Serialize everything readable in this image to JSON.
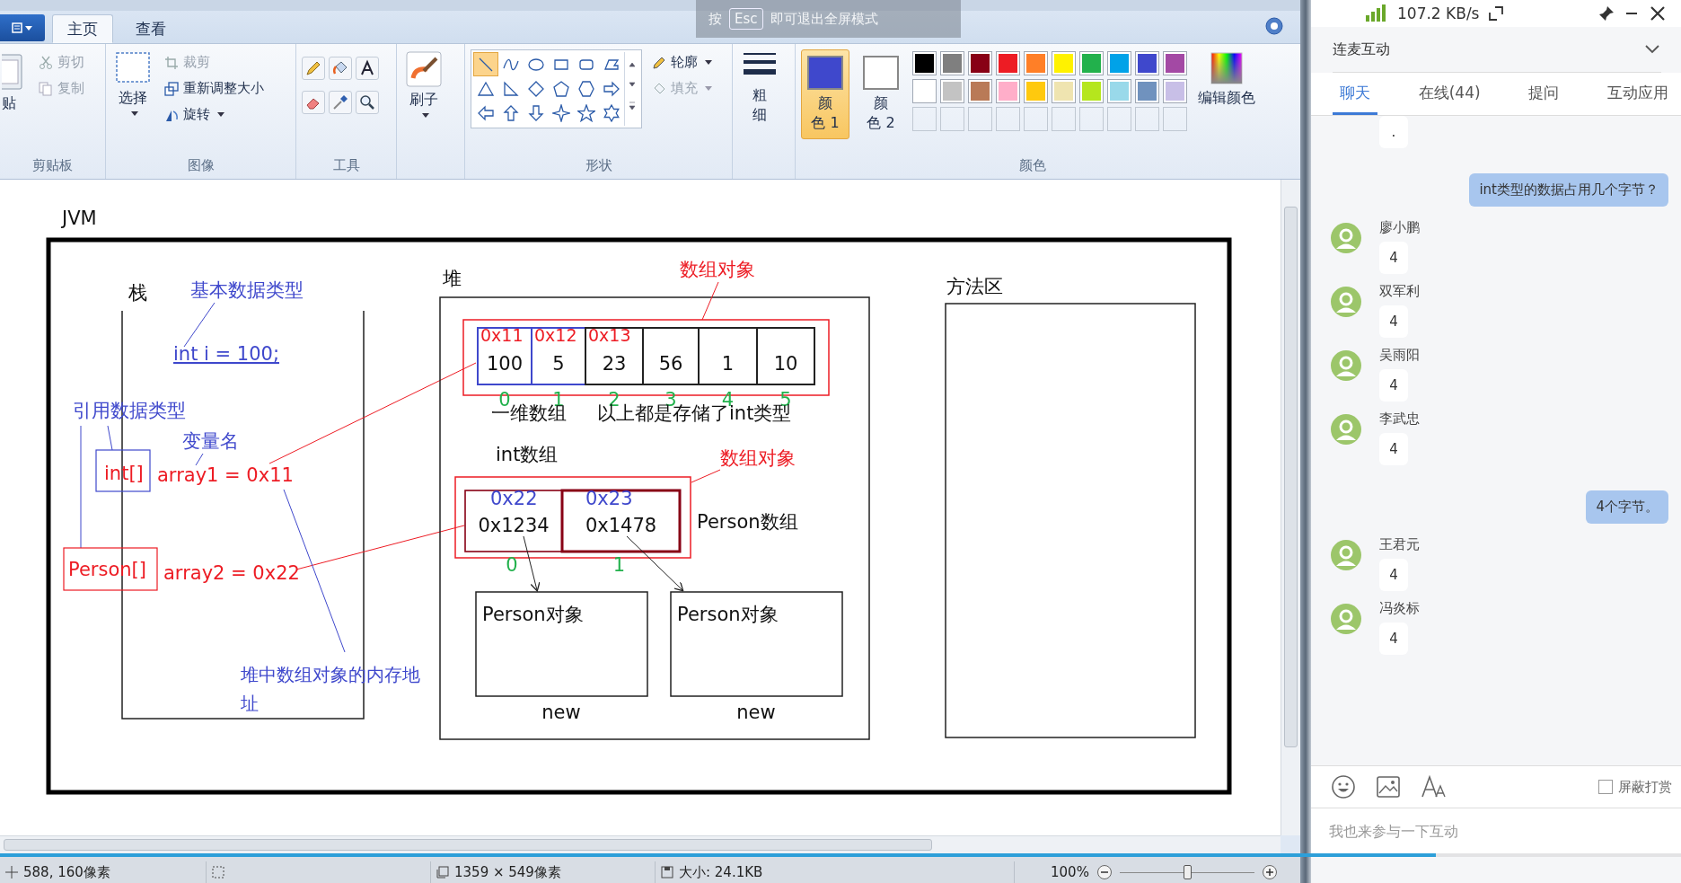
{
  "fullscreen_notice": {
    "before": "按",
    "key": "Esc",
    "after": "即可退出全屏模式"
  },
  "ribbon": {
    "tabs": [
      {
        "label": "主页",
        "selected": true
      },
      {
        "label": "查看",
        "selected": false
      }
    ],
    "clipboard": {
      "label": "剪贴板",
      "paste": "贴",
      "cut": {
        "label": "剪切",
        "disabled": true
      },
      "copy": {
        "label": "复制",
        "disabled": true
      }
    },
    "image": {
      "label": "图像",
      "select": "选择",
      "crop": {
        "label": "裁剪",
        "disabled": true
      },
      "resize": {
        "label": "重新调整大小",
        "disabled": false
      },
      "rotate": {
        "label": "旋转",
        "disabled": false
      }
    },
    "tools": {
      "label": "工具"
    },
    "brush": {
      "label": "刷子"
    },
    "shapes": {
      "label": "形状",
      "items": [
        {
          "kind": "line",
          "selected": true
        },
        {
          "kind": "curve",
          "selected": false
        },
        {
          "kind": "oval",
          "selected": false
        },
        {
          "kind": "rectangle",
          "selected": false
        },
        {
          "kind": "rounded-rectangle",
          "selected": false
        },
        {
          "kind": "polygon",
          "selected": false
        },
        {
          "kind": "triangle",
          "selected": false
        },
        {
          "kind": "right-triangle",
          "selected": false
        },
        {
          "kind": "diamond",
          "selected": false
        },
        {
          "kind": "pentagon",
          "selected": false
        },
        {
          "kind": "hexagon",
          "selected": false
        },
        {
          "kind": "right-arrow",
          "selected": false
        },
        {
          "kind": "left-arrow",
          "selected": false
        },
        {
          "kind": "up-arrow",
          "selected": false
        },
        {
          "kind": "down-arrow",
          "selected": false
        },
        {
          "kind": "four-point-star",
          "selected": false
        },
        {
          "kind": "five-point-star",
          "selected": false
        },
        {
          "kind": "six-point-star",
          "selected": false
        }
      ],
      "outline": {
        "label": "轮廓",
        "disabled": false
      },
      "fill": {
        "label": "填充",
        "disabled": true
      }
    },
    "size": {
      "lines": [
        "粗",
        "细"
      ]
    },
    "colors": {
      "label": "颜色",
      "slots": [
        {
          "lines": [
            "颜",
            "色 1"
          ],
          "selected": true,
          "color": "#3f48cc"
        },
        {
          "lines": [
            "颜",
            "色 2"
          ],
          "selected": false,
          "color": "#ffffff"
        }
      ],
      "palette": [
        {
          "color": "#000000"
        },
        {
          "color": "#7f7f7f"
        },
        {
          "color": "#880015"
        },
        {
          "color": "#ed1c24"
        },
        {
          "color": "#ff7f27"
        },
        {
          "color": "#fff200"
        },
        {
          "color": "#22b14c"
        },
        {
          "color": "#00a2e8"
        },
        {
          "color": "#3f48cc"
        },
        {
          "color": "#a349a4"
        },
        {
          "color": "#ffffff"
        },
        {
          "color": "#c3c3c3"
        },
        {
          "color": "#b97a57"
        },
        {
          "color": "#ffaec9"
        },
        {
          "color": "#ffc90e"
        },
        {
          "color": "#efe4b0"
        },
        {
          "color": "#b5e61d"
        },
        {
          "color": "#99d9ea"
        },
        {
          "color": "#7092be"
        },
        {
          "color": "#c8bfe7"
        }
      ],
      "edit": "编辑颜色"
    }
  },
  "canvas": {
    "title": "JVM",
    "stack": {
      "label": "栈",
      "primitive_note": "基本数据类型",
      "declaration": "int i = 100;",
      "reference_note": "引用数据类型",
      "variable_note": "变量名",
      "int_array_type": "int[]",
      "int_array_assign": "array1 = 0x11",
      "person_array_type": "Person[]",
      "person_array_assign": "array2 = 0x22",
      "address_note": "堆中数组对象的内存地址"
    },
    "heap": {
      "label": "堆",
      "int_array": {
        "caption": "数组对象",
        "cells": [
          {
            "address": "0x11",
            "value": "100",
            "index": "0"
          },
          {
            "address": "0x12",
            "value": "5",
            "index": "1"
          },
          {
            "address": "0x13",
            "value": "23",
            "index": "2"
          },
          {
            "value": "56",
            "index": "3"
          },
          {
            "value": "1",
            "index": "4"
          },
          {
            "value": "10",
            "index": "5"
          }
        ],
        "label": "一维数组",
        "note": "以上都是存储了int类型",
        "type_label": "int数组"
      },
      "person_array": {
        "caption": "数组对象",
        "cells": [
          {
            "address": "0x22",
            "value": "0x1234",
            "index": "0"
          },
          {
            "address": "0x23",
            "value": "0x1478",
            "index": "1"
          }
        ],
        "label": "Person数组"
      },
      "objects": [
        {
          "label": "Person对象",
          "note": "new"
        },
        {
          "label": "Person对象",
          "note": "new"
        }
      ]
    },
    "method_area": {
      "label": "方法区"
    }
  },
  "status_bar": {
    "position": "588, 160像素",
    "dimensions": "1359 × 549像素",
    "size": "大小: 24.1KB",
    "zoom": "100%",
    "level": 0.5
  },
  "chat": {
    "speed": "107.2 KB/s",
    "title": "连麦互动",
    "tabs": [
      {
        "label": "聊天",
        "selected": true
      },
      {
        "label": "在线(44)",
        "selected": false
      },
      {
        "label": "提问",
        "selected": false
      },
      {
        "label": "互动应用",
        "selected": false
      }
    ],
    "messages": [
      {
        "kind": "incoming",
        "text": "."
      },
      {
        "kind": "outgoing",
        "text": "int类型的数据占用几个字节？"
      },
      {
        "kind": "incoming",
        "name": "廖小鹏",
        "text": "4"
      },
      {
        "kind": "incoming",
        "name": "双军利",
        "text": "4"
      },
      {
        "kind": "incoming",
        "name": "吴雨阳",
        "text": "4"
      },
      {
        "kind": "incoming",
        "name": "李武忠",
        "text": "4"
      },
      {
        "kind": "outgoing",
        "text": "4个字节。"
      },
      {
        "kind": "incoming",
        "name": "王君元",
        "text": "4"
      },
      {
        "kind": "incoming",
        "name": "冯炎标",
        "text": "4"
      }
    ],
    "block_gifts": {
      "label": "屏蔽打赏",
      "checked": false
    },
    "input": {
      "placeholder": "我也来参与一下互动"
    }
  },
  "video_progress": {
    "level": 0.854
  }
}
